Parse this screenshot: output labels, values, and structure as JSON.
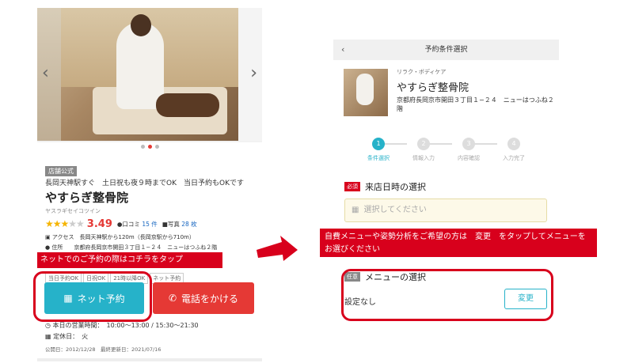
{
  "left": {
    "official_badge": "店舗公式",
    "catch": "長岡天神駅すぐ　土日祝も夜９時までOK　当日予約もOKです",
    "shop_name": "やすらぎ整骨院",
    "shop_kana": "ヤスラギセイコツイン",
    "rating": {
      "stars_filled": 3,
      "stars_total": 5,
      "score": "3.49",
      "reviews_label": "口コミ",
      "reviews_count": "15 件",
      "photos_label": "写真",
      "photos_count": "28 枚"
    },
    "access": "アクセス　長岡天神駅から120m（長岡京駅から710m）",
    "address": "住所　　京都府長岡京市開田３丁目１−２４　ニューはつふね２階",
    "banner": "ネットでのご予約の際はコチラをタップ",
    "tags": [
      "当日予約OK",
      "日祝OK",
      "21時以降OK",
      "ネット予約"
    ],
    "net_button": "ネット予約",
    "call_button": "電話をかける",
    "hours": "本日の営業時間：　10:00〜13:00 / 15:30〜21:30",
    "closed": "定休日：　火",
    "published": "公開日：2012/12/28　最終更新日：2021/07/16"
  },
  "right": {
    "header_title": "予約条件選択",
    "back": "‹",
    "category": "リラク・ボディケア",
    "shop_name": "やすらぎ整骨院",
    "address": "京都府長岡京市開田３丁目１−２４　ニューはつふね２階",
    "steps": [
      {
        "num": "1",
        "label": "条件選択"
      },
      {
        "num": "2",
        "label": "情報入力"
      },
      {
        "num": "3",
        "label": "内容確認"
      },
      {
        "num": "4",
        "label": "入力完了"
      }
    ],
    "required_badge": "必須",
    "visit_title": "来店日時の選択",
    "date_placeholder": "選択してください",
    "banner": "自費メニューや姿勢分析をご希望の方は　変更　をタップしてメニューをお選びください",
    "optional_badge": "任意",
    "menu_title": "メニューの選択",
    "setting_none": "設定なし",
    "change_button": "変更"
  },
  "colors": {
    "accent": "#26b2c9",
    "red": "#d8001c",
    "call": "#e53935",
    "star": "#f5b400"
  }
}
